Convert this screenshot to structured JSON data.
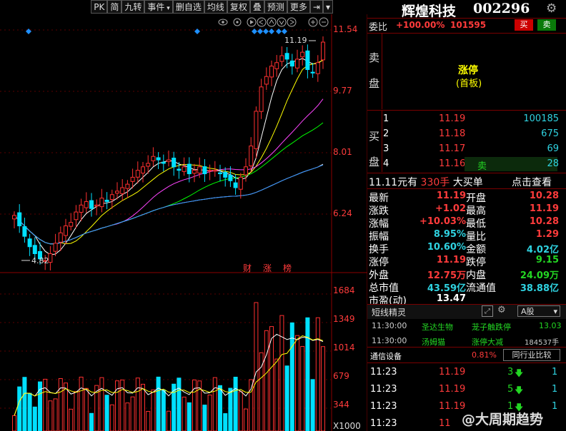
{
  "toolbar": {
    "buttons": [
      "PK",
      "简",
      "九转",
      "事件",
      "删自选",
      "均线",
      "复权",
      "叠",
      "预测",
      "更多"
    ],
    "more_dd_index": 3
  },
  "chart": {
    "price_labels": [
      "11.54",
      "9.77",
      "8.01",
      "6.24"
    ],
    "high_label": "11.19",
    "low_label": "4.82",
    "volume_labels": [
      "1684",
      "1349",
      "1014",
      "679",
      "344"
    ],
    "volume_unit": "X1000",
    "tags": [
      "财",
      "涨",
      "榜"
    ],
    "colors": {
      "up": "#ff3030",
      "down": "#00e0ff",
      "ma5": "#ffffff",
      "ma10": "#ffff00",
      "ma20": "#ff44ff",
      "ma30": "#00ff00",
      "ma60": "#dcdcdc",
      "ma120": "#3090ff"
    }
  },
  "stock": {
    "name": "辉煌科技",
    "code": "002296",
    "gear_icon": "gear-icon",
    "webi_label": "委比",
    "webi_value": "+100.00%",
    "webi_diff": "101595",
    "buy_btn": "买",
    "sell_btn": "卖",
    "sell_side_label": [
      "卖",
      "盘"
    ],
    "limit_title": "涨停",
    "limit_sub": "(首板)",
    "buy_side_label": [
      "买",
      "盘"
    ],
    "bid_rows": [
      {
        "idx": "1",
        "price": "11.19",
        "vol": "100185"
      },
      {
        "idx": "2",
        "price": "11.18",
        "vol": "675"
      },
      {
        "idx": "3",
        "price": "11.17",
        "vol": "69"
      },
      {
        "idx": "4",
        "price": "11.16",
        "vol": "28",
        "tag": "卖"
      }
    ],
    "big_order": {
      "price": "11.11",
      "unit": "元有",
      "hands": "330手",
      "label": "大买单",
      "link": "点击查看"
    },
    "stats_left": [
      {
        "k": "最新",
        "v": "11.19",
        "c": "red"
      },
      {
        "k": "涨跌",
        "v": "+1.02",
        "c": "red"
      },
      {
        "k": "涨幅",
        "v": "+10.03%",
        "c": "red"
      },
      {
        "k": "振幅",
        "v": "8.95%",
        "c": "cyan"
      },
      {
        "k": "换手",
        "v": "10.60%",
        "c": "cyan"
      },
      {
        "k": "涨停",
        "v": "11.19",
        "c": "red"
      },
      {
        "k": "外盘",
        "v": "12.75万",
        "c": "red"
      },
      {
        "k": "总市值",
        "v": "43.59亿",
        "c": "cyan"
      },
      {
        "k": "市盈(动)",
        "v": "13.47",
        "c": "white"
      }
    ],
    "stats_right": [
      {
        "k": "开盘",
        "v": "10.28",
        "c": "red"
      },
      {
        "k": "最高",
        "v": "11.19",
        "c": "red"
      },
      {
        "k": "最低",
        "v": "10.28",
        "c": "red"
      },
      {
        "k": "量比",
        "v": "1.29",
        "c": "red"
      },
      {
        "k": "金额",
        "v": "4.02亿",
        "c": "cyan"
      },
      {
        "k": "跌停",
        "v": "9.15",
        "c": "green"
      },
      {
        "k": "内盘",
        "v": "24.09万",
        "c": "green"
      },
      {
        "k": "流通值",
        "v": "38.88亿",
        "c": "cyan"
      }
    ],
    "short_line": {
      "title": "短线精灵",
      "dropdown": "A股"
    },
    "alerts": [
      {
        "time": "11:30:00",
        "name": "圣达生物",
        "event": "茏子触跌停",
        "extra": "13.03",
        "color": "green"
      },
      {
        "time": "11:30:00",
        "name": "汤姆猫",
        "event": "涨停大减",
        "extra": "184537手",
        "color": "green"
      }
    ],
    "industry": {
      "name": "通信设备",
      "pct": "0.81%",
      "btn": "同行业比较"
    },
    "ticks": [
      {
        "time": "11:23",
        "price": "11.19",
        "vol": "3",
        "dir": "down",
        "n": "1"
      },
      {
        "time": "11:23",
        "price": "11.19",
        "vol": "5",
        "dir": "down",
        "n": "1"
      },
      {
        "time": "11:23",
        "price": "11.19",
        "vol": "1",
        "dir": "down",
        "n": "1"
      },
      {
        "time": "11:23",
        "price": "11",
        "vol": "",
        "dir": "",
        "n": ""
      }
    ],
    "watermark": "@大周期趋势"
  }
}
